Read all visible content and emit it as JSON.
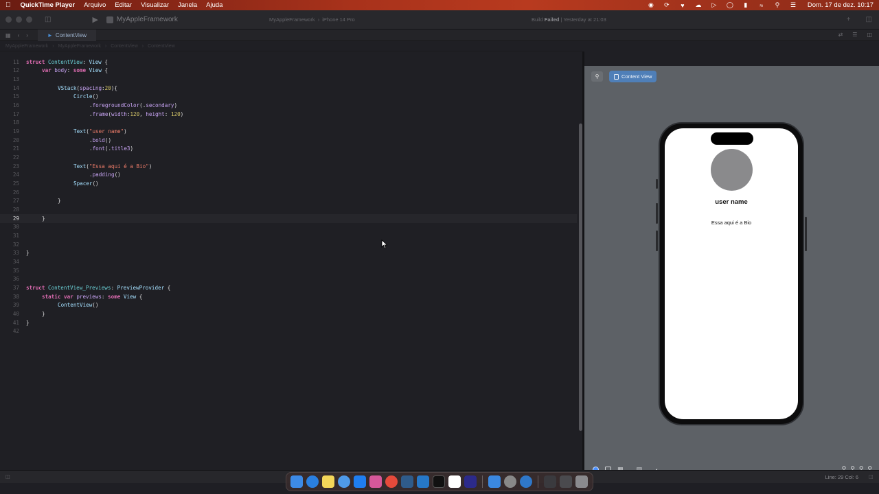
{
  "menubar": {
    "app_name": "QuickTime Player",
    "items": [
      "Arquivo",
      "Editar",
      "Visualizar",
      "Janela",
      "Ajuda"
    ],
    "clock": "Dom. 17 de dez.  10:17"
  },
  "toolbar": {
    "project": "MyAppleFramework",
    "scheme_project": "MyAppleFramework",
    "scheme_device": "iPhone 14 Pro",
    "status_prefix": "Build",
    "status_state": "Failed",
    "status_time": "Yesterday at 21:03"
  },
  "tab": {
    "label": "ContentView"
  },
  "jumpbar": [
    "MyAppleFramework",
    "MyAppleFramework",
    "ContentView",
    "ContentView"
  ],
  "editor": {
    "current_line": 29,
    "lines": [
      11,
      12,
      13,
      14,
      15,
      16,
      17,
      18,
      19,
      20,
      21,
      22,
      23,
      24,
      25,
      26,
      27,
      28,
      29,
      30,
      31,
      32,
      33,
      34,
      35,
      36,
      37,
      38,
      39,
      40,
      41,
      42
    ]
  },
  "preview": {
    "chip_label": "Content View",
    "username": "user name",
    "bio": "Essa aqui é a Bio"
  },
  "statusbar": {
    "position": "Line: 29  Col: 6"
  },
  "colors": {
    "keyword": "#e06db3",
    "type": "#6bd0d6",
    "string": "#f07d6a",
    "number": "#d7c86a",
    "accent": "#4f7fb8",
    "build_failed": "#8a8a8f"
  }
}
